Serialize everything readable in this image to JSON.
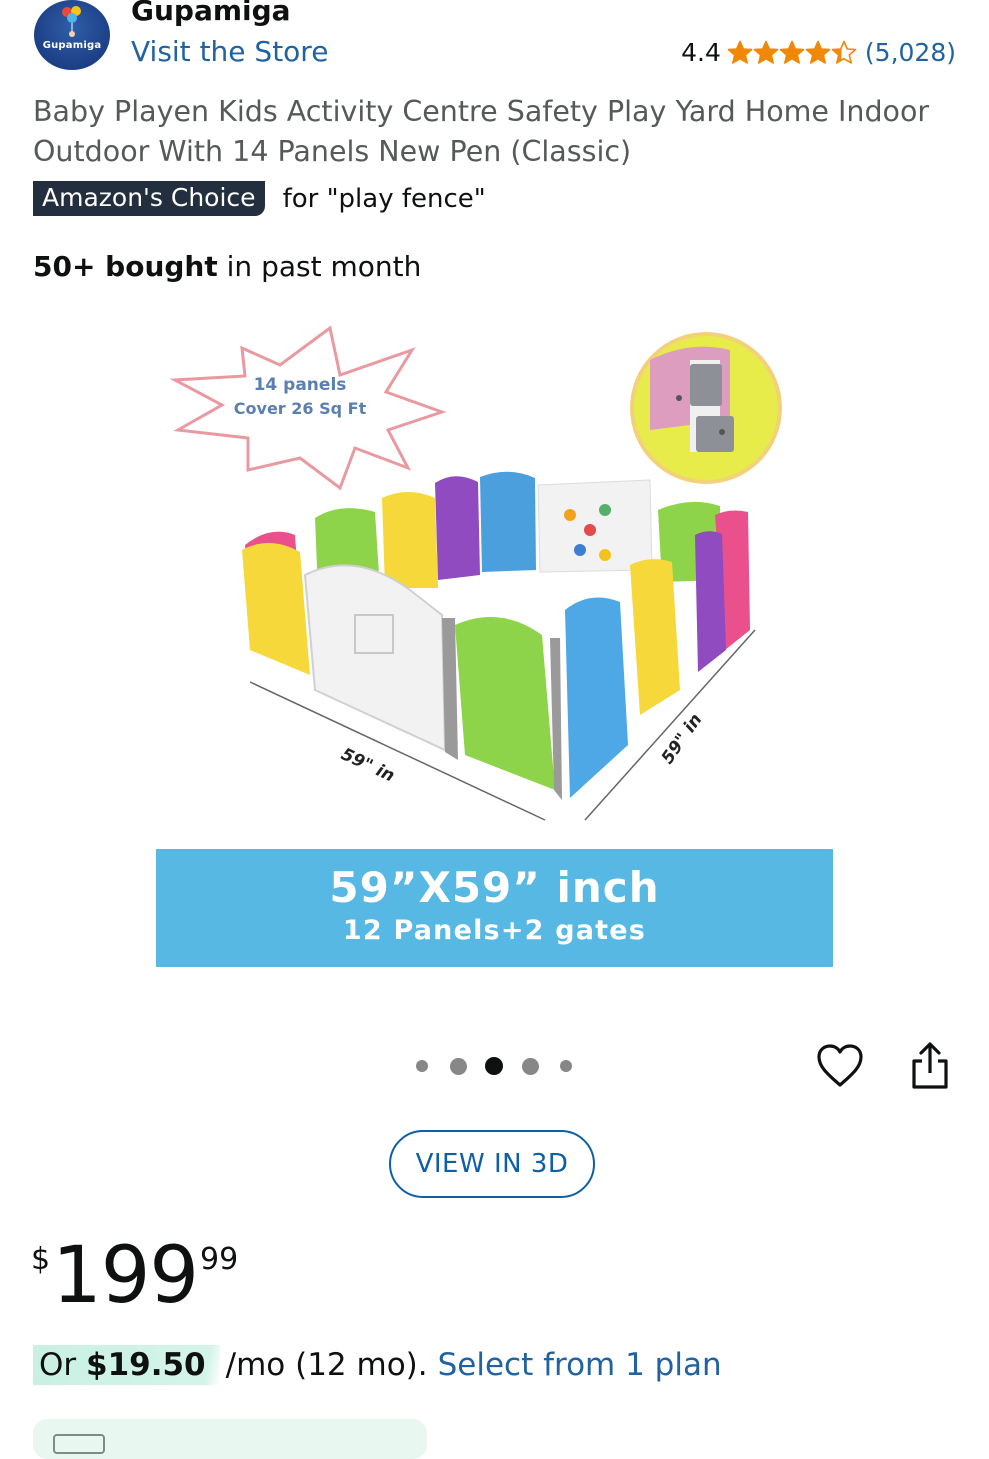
{
  "store": {
    "logo_text": "Gupamiga",
    "name": "Gupamiga",
    "visit_label": "Visit the Store"
  },
  "rating": {
    "value": "4.4",
    "stars": 4.4,
    "count": "(5,028)",
    "star_color": "#f08804"
  },
  "product": {
    "title": "Baby Playen Kids Activity Centre Safety Play Yard Home Indoor Outdoor With 14 Panels New Pen (Classic)",
    "badge": "Amazon's Choice",
    "badge_for": "for \"play fence\"",
    "bought_bold": "50+ bought",
    "bought_rest": " in past month"
  },
  "image": {
    "starburst_line1": "14 panels",
    "starburst_line2": "Cover 26 Sq Ft",
    "dim_left": "59\" in",
    "dim_right": "59\" in",
    "banner_line1": "59”X59” inch",
    "banner_line2": "12 Panels+2 gates",
    "banner_color": "#56b8e3"
  },
  "carousel": {
    "dot_count": 5,
    "active_index": 2
  },
  "actions": {
    "wishlist_icon": "heart-icon",
    "share_icon": "share-icon",
    "view3d_label": "VIEW IN 3D"
  },
  "price": {
    "symbol": "$",
    "whole": "199",
    "fraction": "99"
  },
  "monthly": {
    "prefix": "Or ",
    "amount": "$19.50",
    "rest": "/mo (12 mo).",
    "link": "Select from 1 plan"
  }
}
